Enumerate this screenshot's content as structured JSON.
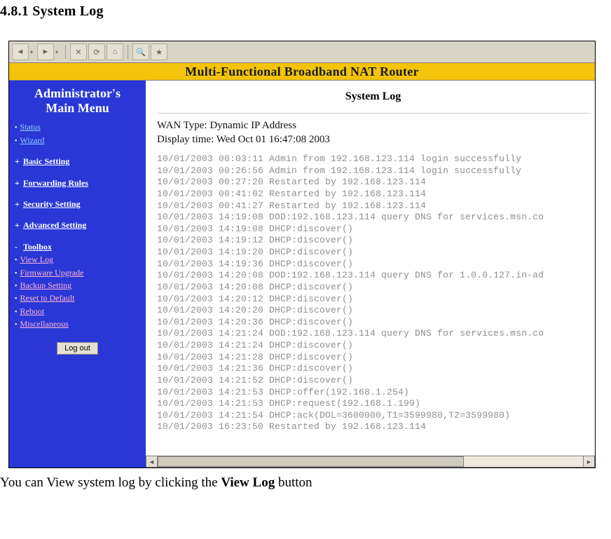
{
  "doc": {
    "heading": "4.8.1 System Log",
    "caption_plain": "You can View system log by clicking the ",
    "caption_bold": "View Log",
    "caption_tail": " button"
  },
  "banner": "Multi-Functional Broadband NAT Router",
  "sidebar": {
    "title_l1": "Administrator's",
    "title_l2": "Main Menu",
    "items": {
      "status": "Status",
      "wizard": "Wizard",
      "basic": "Basic Setting",
      "fwd": "Forwarding Rules",
      "security": "Security Setting",
      "advanced": "Advanced Setting",
      "toolbox": "Toolbox",
      "viewlog": "View Log",
      "firmware": "Firmware Upgrade",
      "backup": "Backup Setting",
      "reset": "Reset to Default",
      "reboot": "Reboot",
      "misc": "Miscellaneous"
    },
    "logout": "Log out"
  },
  "content": {
    "title": "System Log",
    "wan_line": "WAN Type: Dynamic IP Address",
    "disp_line": "Display time: Wed Oct 01 16:47:08 2003",
    "log_lines": [
      "10/01/2003 00:03:11 Admin from 192.168.123.114 login successfully",
      "10/01/2003 00:26:56 Admin from 192.168.123.114 login successfully",
      "10/01/2003 00:27:20 Restarted by 192.168.123.114",
      "10/01/2003 00:41:02 Restarted by 192.168.123.114",
      "10/01/2003 00:41:27 Restarted by 192.168.123.114",
      "10/01/2003 14:19:08 DOD:192.168.123.114 query DNS for services.msn.co",
      "10/01/2003 14:19:08 DHCP:discover()",
      "10/01/2003 14:19:12 DHCP:discover()",
      "10/01/2003 14:19:20 DHCP:discover()",
      "10/01/2003 14:19:36 DHCP:discover()",
      "10/01/2003 14:20:08 DOD:192.168.123.114 query DNS for 1.0.0.127.in-ad",
      "10/01/2003 14:20:08 DHCP:discover()",
      "10/01/2003 14:20:12 DHCP:discover()",
      "10/01/2003 14:20:20 DHCP:discover()",
      "10/01/2003 14:20:36 DHCP:discover()",
      "10/01/2003 14:21:24 DOD:192.168.123.114 query DNS for services.msn.co",
      "10/01/2003 14:21:24 DHCP:discover()",
      "10/01/2003 14:21:28 DHCP:discover()",
      "10/01/2003 14:21:36 DHCP:discover()",
      "10/01/2003 14:21:52 DHCP:discover()",
      "10/01/2003 14:21:53 DHCP:offer(192.168.1.254)",
      "10/01/2003 14:21:53 DHCP:request(192.168.1.199)",
      "10/01/2003 14:21:54 DHCP:ack(DOL=3600000,T1=3599980,T2=3599980)",
      "10/01/2003 16:23:50 Restarted by 192.168.123.114"
    ]
  }
}
